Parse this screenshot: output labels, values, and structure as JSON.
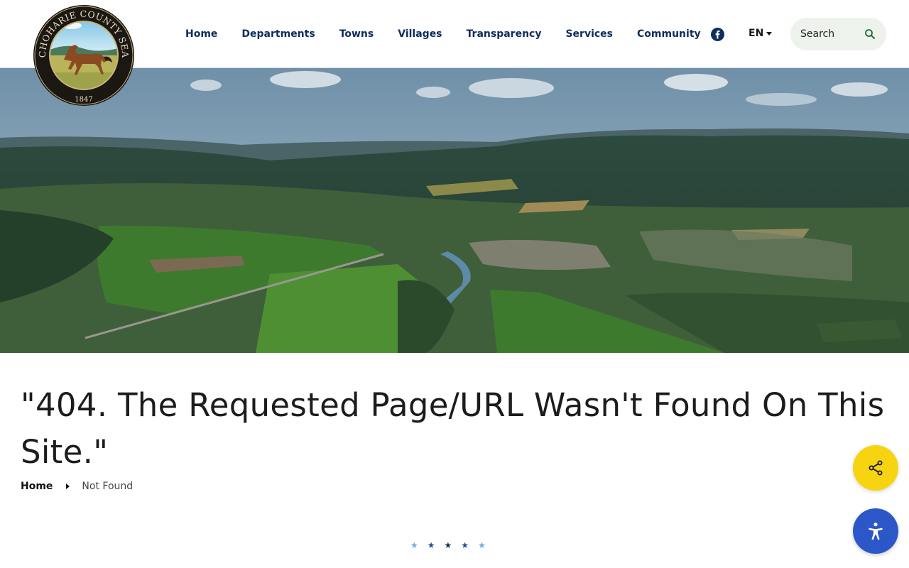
{
  "logo": {
    "seal_text": "SCHOHARIE COUNTY SEAL",
    "year": "1847"
  },
  "nav": {
    "items": [
      {
        "label": "Home"
      },
      {
        "label": "Departments"
      },
      {
        "label": "Towns"
      },
      {
        "label": "Villages"
      },
      {
        "label": "Transparency"
      },
      {
        "label": "Services"
      },
      {
        "label": "Community"
      }
    ]
  },
  "header": {
    "social_icon": "facebook-icon",
    "language": "EN",
    "search_label": "Search",
    "search_icon": "search-icon"
  },
  "page": {
    "title": "\"404. The Requested Page/URL Wasn't Found On This Site.\"",
    "breadcrumb": {
      "home": "Home",
      "current": "Not Found"
    }
  },
  "decor": {
    "star_colors": [
      "#6ea8e8",
      "#1f4f9c",
      "#0f2d5c",
      "#1f4f9c",
      "#6ea8e8"
    ]
  },
  "floating": {
    "share_icon": "share-icon",
    "accessibility_icon": "accessibility-icon"
  },
  "colors": {
    "nav_text": "#0f2d5c",
    "share_button": "#f7d411",
    "accessibility_button": "#2c57c9",
    "search_bg": "#eef2ec"
  }
}
